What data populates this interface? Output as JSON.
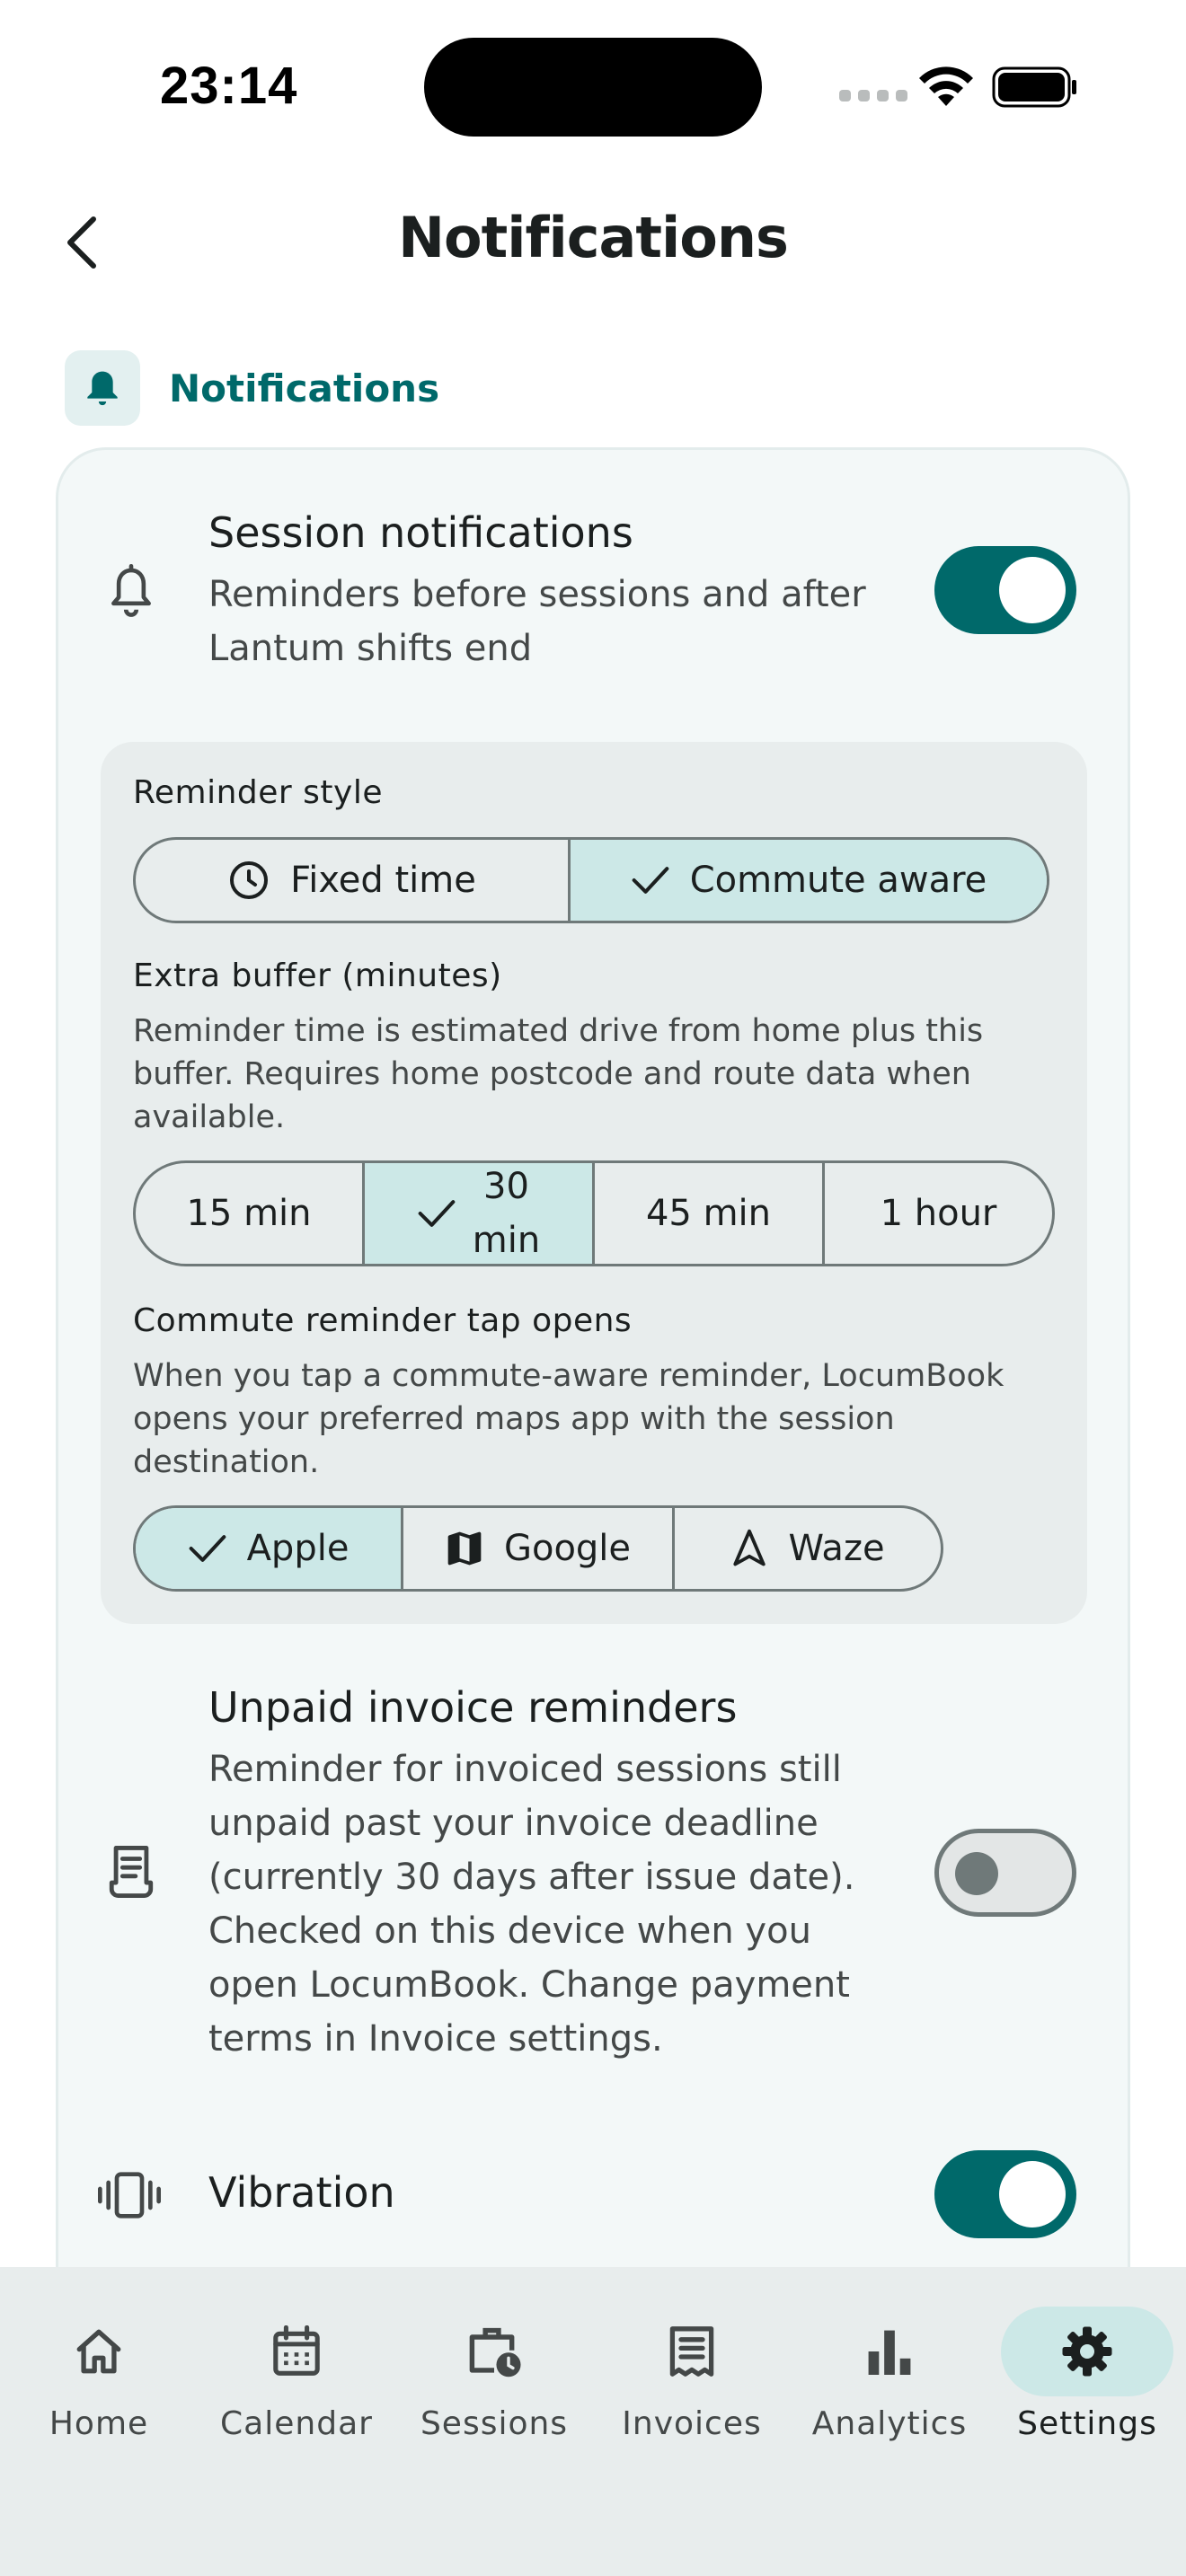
{
  "status": {
    "time": "23:14"
  },
  "header": {
    "title": "Notifications"
  },
  "section": {
    "label": "Notifications"
  },
  "session_notifications": {
    "title": "Session notifications",
    "description_line1": "Reminders before sessions and after",
    "description_line2": "Lantum shifts end",
    "enabled": true
  },
  "reminder_style": {
    "label": "Reminder style",
    "options": [
      "Fixed time",
      "Commute aware"
    ],
    "selected": "Commute aware"
  },
  "extra_buffer": {
    "label": "Extra buffer (minutes)",
    "description_line1": "Reminder time is estimated drive from home plus this",
    "description_line2": "buffer. Requires home postcode and route data when",
    "description_line3": "available.",
    "options": [
      "15 min",
      "30",
      "min",
      "45 min",
      "1 hour"
    ],
    "selected": "30 min"
  },
  "commute_tap": {
    "label": "Commute reminder tap opens",
    "description_line1": "When you tap a commute-aware reminder, LocumBook",
    "description_line2": "opens your preferred maps app with the session",
    "description_line3": "destination.",
    "options": [
      "Apple",
      "Google",
      "Waze"
    ],
    "selected": "Apple"
  },
  "invoice_reminders": {
    "title": "Unpaid invoice reminders",
    "lines": [
      "Reminder for invoiced sessions still",
      "unpaid past your invoice deadline",
      "(currently 30 days after issue date).",
      "Checked on this device when you",
      "open LocumBook. Change payment",
      "terms in Invoice settings."
    ],
    "enabled": false
  },
  "vibration": {
    "title": "Vibration",
    "enabled": true
  },
  "bottom_nav": {
    "items": [
      {
        "label": "Home",
        "icon": "home-icon"
      },
      {
        "label": "Calendar",
        "icon": "calendar-icon"
      },
      {
        "label": "Sessions",
        "icon": "work-history-icon"
      },
      {
        "label": "Invoices",
        "icon": "receipt-icon"
      },
      {
        "label": "Analytics",
        "icon": "bar-chart-icon"
      },
      {
        "label": "Settings",
        "icon": "gear-icon"
      }
    ],
    "active": "Settings"
  },
  "colors": {
    "primary": "#00696a",
    "selected_container": "#cce8e7",
    "surface": "#f3f8f8",
    "panel": "#e8eded"
  }
}
